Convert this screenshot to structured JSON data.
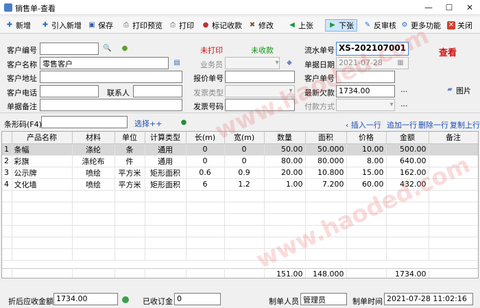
{
  "window": {
    "title": "销售单-查看"
  },
  "toolbar": {
    "new": "新增",
    "import_new": "引入新增",
    "save": "保存",
    "print_preview": "打印预览",
    "print": "打印",
    "mark_paid": "标记收款",
    "edit": "修改",
    "prev": "上张",
    "next": "下张",
    "unapprove": "反审核",
    "more": "更多功能",
    "close": "关闭"
  },
  "form": {
    "customer_code_label": "客户编号",
    "customer_code": "",
    "customer_name_label": "客户名称",
    "customer_name": "零售客户",
    "customer_address_label": "客户地址",
    "customer_address": "",
    "customer_phone_label": "客户电话",
    "customer_phone": "",
    "contact_label": "联系人",
    "contact": "",
    "remark_label": "单据备注",
    "remark": "",
    "print_status": "未打印",
    "pay_status": "未收款",
    "salesman_label": "业务员",
    "salesman": "",
    "quote_no_label": "报价单号",
    "quote_no": "",
    "invoice_type_label": "发票类型",
    "invoice_type": "",
    "invoice_no_label": "发票号码",
    "invoice_no": "",
    "serial_label": "流水单号",
    "serial": "XS-202107001",
    "date_label": "单据日期",
    "date": "2021-07-28",
    "customer_order_label": "客户单号",
    "customer_order": "",
    "latest_owed_label": "最新欠款",
    "latest_owed": "1734.00",
    "pay_method_label": "付款方式",
    "pay_method": "",
    "view_mode": "查看",
    "image_label": "图片",
    "barcode_label": "条形码(F4)",
    "barcode": "",
    "select_label": "选择++",
    "insert_row": "插入一行",
    "append_row": "追加一行",
    "delete_row": "删除一行",
    "copy_row": "复制上行",
    "ellipsis": "..."
  },
  "table": {
    "headers": [
      "",
      "产品名称",
      "材料",
      "单位",
      "计算类型",
      "长(m)",
      "宽(m)",
      "数量",
      "面积",
      "价格",
      "金额",
      "备注"
    ],
    "rows": [
      [
        "1",
        "条幅",
        "涤纶",
        "条",
        "通用",
        "0",
        "0",
        "50.00",
        "50.000",
        "10.00",
        "500.00",
        ""
      ],
      [
        "2",
        "彩旗",
        "涤纶布",
        "件",
        "通用",
        "0",
        "0",
        "80.00",
        "80.000",
        "8.00",
        "640.00",
        ""
      ],
      [
        "3",
        "公示牌",
        "喷绘",
        "平方米",
        "矩形面积",
        "0.6",
        "0.9",
        "20.00",
        "10.800",
        "15.00",
        "162.00",
        ""
      ],
      [
        "4",
        "文化墙",
        "喷绘",
        "平方米",
        "矩形面积",
        "6",
        "1.2",
        "1.00",
        "7.200",
        "60.00",
        "432.00",
        ""
      ]
    ],
    "totals": {
      "qty": "151.00",
      "area": "148.000",
      "amount": "1734.00"
    }
  },
  "footer": {
    "receivable_label": "折后应收金额",
    "receivable": "1734.00",
    "deposit_label": "已收订金",
    "deposit": "0",
    "maker_label": "制单人员",
    "maker": "管理员",
    "time_label": "制单时间",
    "time": "2021-07-28 11:02:16"
  },
  "watermark": "www.haoded.com",
  "colors": {
    "accent": "#3c7fd8",
    "status_red": "#d01010",
    "status_green": "#119911"
  }
}
